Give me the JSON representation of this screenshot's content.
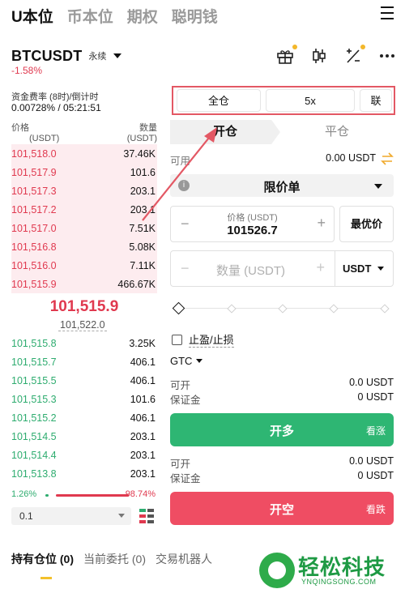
{
  "top_tabs": [
    "U本位",
    "币本位",
    "期权",
    "聪明钱"
  ],
  "symbol": {
    "name": "BTCUSDT",
    "contract_type": "永续",
    "change": "-1.58%"
  },
  "funding": {
    "label": "资金费率 (8时)/倒计时",
    "value": "0.00728% / 05:21:51"
  },
  "orderbook": {
    "price_header": "价格",
    "price_unit": "(USDT)",
    "qty_header": "数量",
    "qty_unit": "(USDT)",
    "asks": [
      {
        "price": "101,518.0",
        "qty": "37.46K"
      },
      {
        "price": "101,517.9",
        "qty": "101.6"
      },
      {
        "price": "101,517.3",
        "qty": "203.1"
      },
      {
        "price": "101,517.2",
        "qty": "203.1"
      },
      {
        "price": "101,517.0",
        "qty": "7.51K"
      },
      {
        "price": "101,516.8",
        "qty": "5.08K"
      },
      {
        "price": "101,516.0",
        "qty": "7.11K"
      },
      {
        "price": "101,515.9",
        "qty": "466.67K"
      }
    ],
    "last_price": "101,515.9",
    "mark_price": "101,522.0",
    "bids": [
      {
        "price": "101,515.8",
        "qty": "3.25K"
      },
      {
        "price": "101,515.7",
        "qty": "406.1"
      },
      {
        "price": "101,515.5",
        "qty": "406.1"
      },
      {
        "price": "101,515.3",
        "qty": "101.6"
      },
      {
        "price": "101,515.2",
        "qty": "406.1"
      },
      {
        "price": "101,514.5",
        "qty": "203.1"
      },
      {
        "price": "101,514.4",
        "qty": "203.1"
      },
      {
        "price": "101,513.8",
        "qty": "203.1"
      }
    ],
    "bid_ratio": "1.26%",
    "ask_ratio": "98.74%",
    "precision": "0.1"
  },
  "margin": {
    "mode": "全仓",
    "leverage": "5x",
    "extra": "联"
  },
  "position_tabs": {
    "open": "开仓",
    "close": "平仓"
  },
  "available": {
    "label": "可用",
    "value": "0.00 USDT"
  },
  "order_type": "限价单",
  "price_input": {
    "label": "价格 (USDT)",
    "value": "101526.7"
  },
  "best_price": "最优价",
  "qty_input": {
    "placeholder": "数量 (USDT)",
    "unit": "USDT"
  },
  "tpsl_label": "止盈/止损",
  "time_in_force": "GTC",
  "long_info": {
    "open_label": "可开",
    "open_value": "0.0 USDT",
    "margin_label": "保证金",
    "margin_value": "0 USDT"
  },
  "long_button": {
    "label": "开多",
    "side": "看涨"
  },
  "short_info": {
    "open_label": "可开",
    "open_value": "0.0 USDT",
    "margin_label": "保证金",
    "margin_value": "0 USDT"
  },
  "short_button": {
    "label": "开空",
    "side": "看跌"
  },
  "bottom_tabs": [
    "持有仓位 (0)",
    "当前委托 (0)",
    "交易机器人"
  ],
  "watermark": {
    "text": "轻松科技",
    "url": "YNQINGSONG.COM"
  },
  "colors": {
    "red": "#e0394f",
    "green": "#2eac6f",
    "accent": "#f3c12b"
  }
}
